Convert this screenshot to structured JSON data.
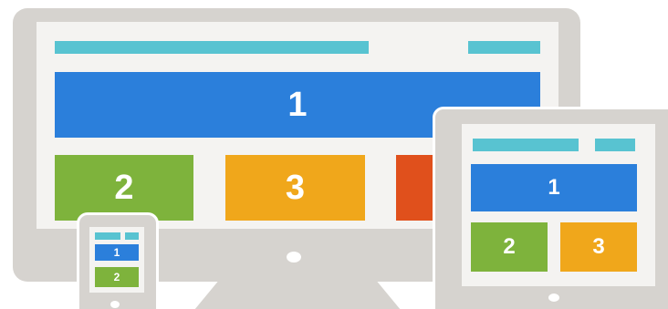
{
  "illustration": {
    "colors": {
      "device_frame": "#d6d3cf",
      "screen_bg": "#f4f3f1",
      "header_bar": "#58c3d1",
      "block_1": "#2b7fdb",
      "block_2": "#7eb33c",
      "block_3": "#f0a71b",
      "block_4": "#e0501c"
    },
    "desktop": {
      "block_1_label": "1",
      "block_2_label": "2",
      "block_3_label": "3"
    },
    "tablet": {
      "block_1_label": "1",
      "block_2_label": "2",
      "block_3_label": "3"
    },
    "phone": {
      "block_1_label": "1",
      "block_2_label": "2"
    }
  }
}
